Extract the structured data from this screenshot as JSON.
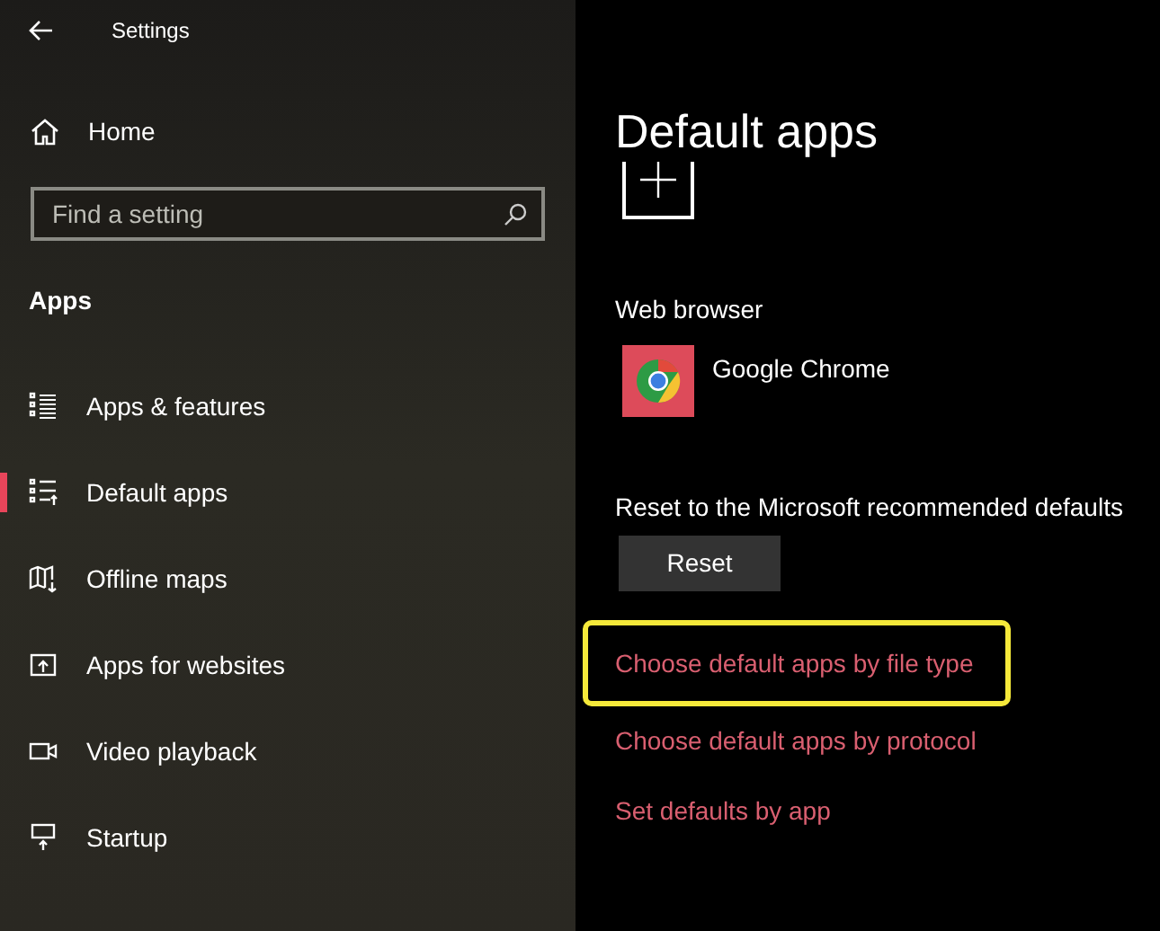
{
  "window": {
    "title": "Settings"
  },
  "sidebar": {
    "home": "Home",
    "search": {
      "placeholder": "Find a setting"
    },
    "section": "Apps",
    "items": [
      {
        "label": "Apps & features",
        "selected": false
      },
      {
        "label": "Default apps",
        "selected": true
      },
      {
        "label": "Offline maps",
        "selected": false
      },
      {
        "label": "Apps for websites",
        "selected": false
      },
      {
        "label": "Video playback",
        "selected": false
      },
      {
        "label": "Startup",
        "selected": false
      }
    ]
  },
  "main": {
    "heading": "Default apps",
    "web_browser": {
      "label": "Web browser",
      "app": "Google Chrome"
    },
    "reset": {
      "label": "Reset to the Microsoft recommended defaults",
      "button": "Reset"
    },
    "links": [
      {
        "label": "Choose default apps by file type",
        "highlighted": true
      },
      {
        "label": "Choose default apps by protocol",
        "highlighted": false
      },
      {
        "label": "Set defaults by app",
        "highlighted": false
      }
    ]
  }
}
